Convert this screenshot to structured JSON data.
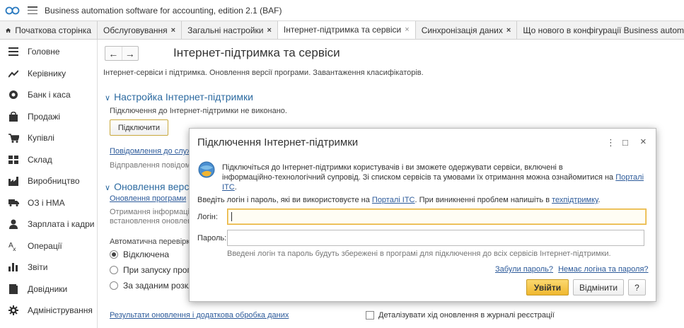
{
  "app": {
    "title": "Business automation software for accounting, edition 2.1  (BAF)",
    "logo_icon": "1c-logo-icon",
    "menu_icon": "hamburger-menu-icon"
  },
  "tabs": [
    {
      "label": "Початкова сторінка",
      "icon": "home-icon"
    },
    {
      "label": "Обслуговування",
      "close": "×"
    },
    {
      "label": "Загальні настройки",
      "close": "×"
    },
    {
      "label": "Інтернет-підтримка та сервіси",
      "close": "×",
      "active": true
    },
    {
      "label": "Синхронізація даних",
      "close": "×"
    },
    {
      "label": "Що нового в конфігурації Business automation software for"
    }
  ],
  "sidebar": {
    "items": [
      {
        "label": "Головне",
        "icon": "menu-lines-icon"
      },
      {
        "label": "Керівнику",
        "icon": "trend-chart-icon"
      },
      {
        "label": "Банк і каса",
        "icon": "coin-icon"
      },
      {
        "label": "Продажі",
        "icon": "shopping-bag-icon"
      },
      {
        "label": "Купівлі",
        "icon": "cart-icon"
      },
      {
        "label": "Склад",
        "icon": "warehouse-grid-icon"
      },
      {
        "label": "Виробництво",
        "icon": "factory-icon"
      },
      {
        "label": "ОЗ і НМА",
        "icon": "truck-icon"
      },
      {
        "label": "Зарплата і кадри",
        "icon": "person-icon"
      },
      {
        "label": "Операції",
        "icon": "operations-icon"
      },
      {
        "label": "Звіти",
        "icon": "bar-report-icon"
      },
      {
        "label": "Довідники",
        "icon": "book-icon"
      },
      {
        "label": "Адміністрування",
        "icon": "gear-icon"
      }
    ]
  },
  "main": {
    "back": "←",
    "forward": "→",
    "title": "Інтернет-підтримка та сервіси",
    "subtitle": "Інтернет-сервіси і підтримка. Оновлення версії програми. Завантаження класифікаторів.",
    "section1": {
      "chevron": "∨",
      "title": "Настройка Інтернет-підтримки",
      "status": "Підключення до Інтернет-підтримки не виконано.",
      "connect_button": "Підключити"
    },
    "messages_link": "Повідомлення до служ",
    "messages_desc": "Відправлення повідом",
    "section2": {
      "chevron": "∨",
      "title": "Оновлення версі",
      "link": "Оновлення програми",
      "desc1": "Отримання інформації",
      "desc2": "встановлення оновлен",
      "auto_check": "Автоматична перевірк",
      "radio_disabled": "Відключена",
      "radio_on_start": "При запуску програ",
      "radio_schedule": "За заданим розкла"
    },
    "results_link": "Результати оновлення і додаткова обробка даних",
    "detail_checkbox": "Деталізувати хід оновлення в журналі реєстрації"
  },
  "dialog": {
    "title": "Підключення Інтернет-підтримки",
    "more_icon": "⋮",
    "maximize_icon": "□",
    "close_icon": "×",
    "info_line1": "Підключіться до Інтернет-підтримки користувачів і ви зможете одержувати сервіси, включені в",
    "info_line2": "інформаційно-технологічний супровід. Зі списком сервісів та умовами їх отримання можна ознайомитися на",
    "portal_link": "Порталі ІТС",
    "dot": ".",
    "prompt_prefix": "Введіть логін і пароль, які ви використовуєте на",
    "prompt_middle": ". При виникненні проблем напишіть в",
    "support_link": "техпідтримку",
    "login_label": "Логін:",
    "login_value": "",
    "password_label": "Пароль:",
    "password_value": "",
    "hint": "Введені логін та пароль будуть збережені в програмі для підключення до всіх сервісів Інтернет-підтримки.",
    "forgot_link": "Забули пароль?",
    "no_login_link": "Немає логіна та пароля?",
    "login_button": "Увійти",
    "cancel_button": "Відмінити",
    "help_button": "?"
  }
}
